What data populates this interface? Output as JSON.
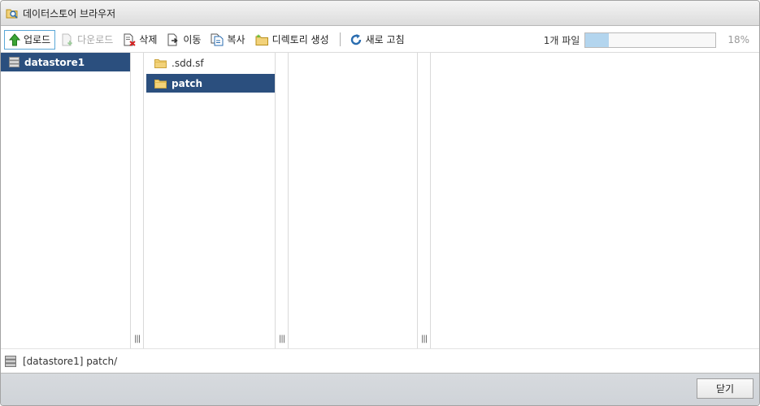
{
  "window": {
    "title": "데이터스토어 브라우저"
  },
  "toolbar": {
    "upload_label": "업로드",
    "download_label": "다운로드",
    "delete_label": "삭제",
    "move_label": "이동",
    "copy_label": "복사",
    "new_folder_label": "디렉토리 생성",
    "refresh_label": "새로 고침",
    "file_count": "1개 파일",
    "progress_percent": 18,
    "progress_text": "18%"
  },
  "columns": {
    "datastores": [
      {
        "name": "datastore1",
        "selected": true
      }
    ],
    "folders": [
      {
        "name": ".sdd.sf",
        "selected": false
      },
      {
        "name": "patch",
        "selected": true
      }
    ]
  },
  "status": {
    "path": "[datastore1] patch/"
  },
  "footer": {
    "close_label": "닫기"
  },
  "colors": {
    "selection": "#2b4f7e",
    "progress_fill": "#b3d5ee",
    "folder": "#f2d27a"
  }
}
